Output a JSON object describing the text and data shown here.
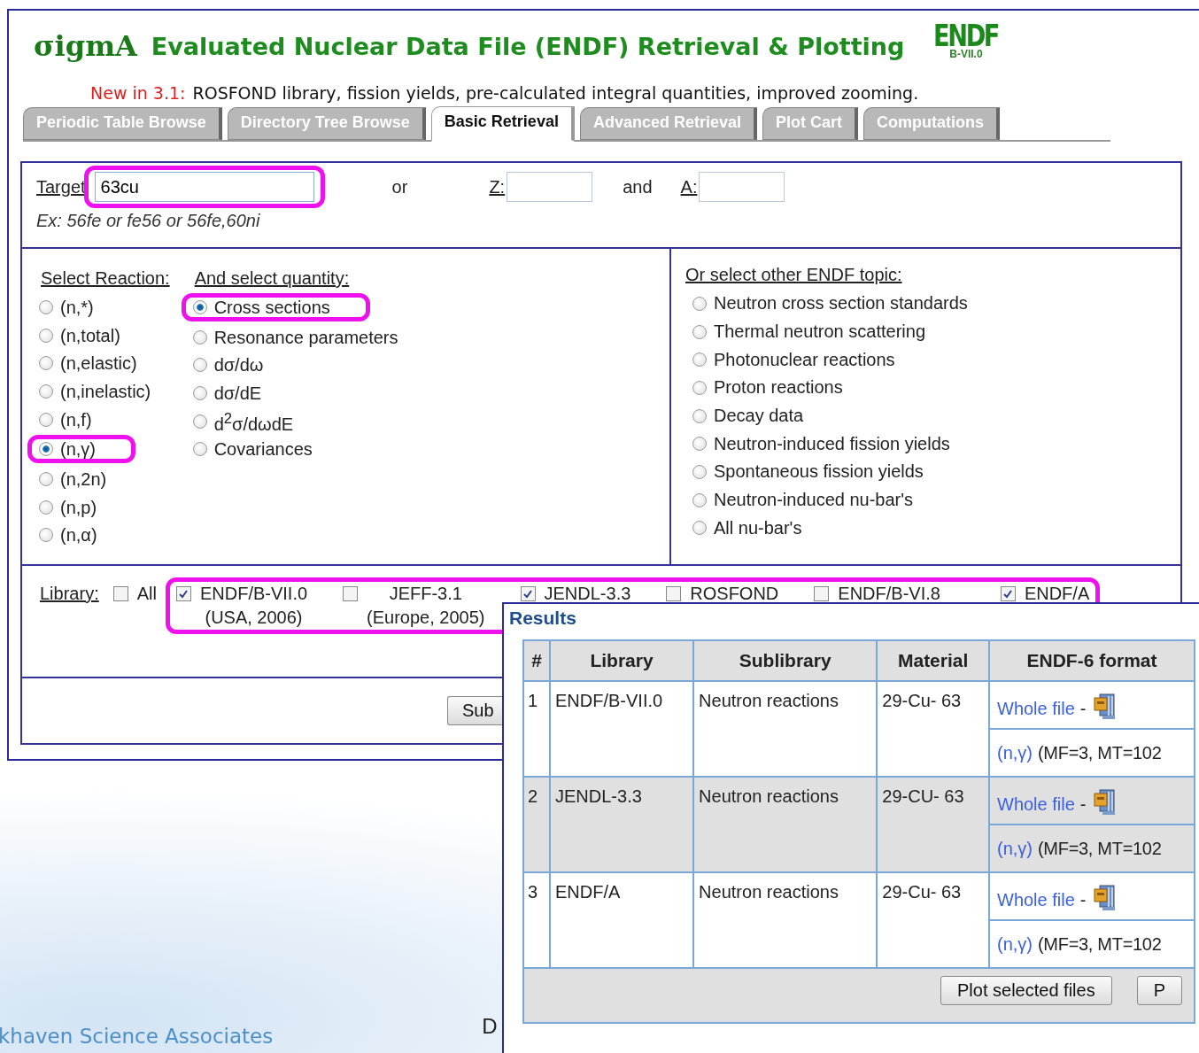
{
  "header": {
    "logo": "σigmA",
    "title": "Evaluated Nuclear Data File (ENDF) Retrieval & Plotting",
    "badge": {
      "title": "ENDF",
      "subtitle": "B-VII.0"
    },
    "news_label": "New in 3.1:",
    "news": "ROSFOND library, fission yields, pre-calculated integral quantities, improved zooming."
  },
  "tabs": [
    {
      "label": "Periodic Table Browse",
      "selected": false
    },
    {
      "label": "Directory Tree Browse",
      "selected": false
    },
    {
      "label": "Basic Retrieval",
      "selected": true
    },
    {
      "label": "Advanced Retrieval",
      "selected": false
    },
    {
      "label": "Plot Cart",
      "selected": false
    },
    {
      "label": "Computations",
      "selected": false
    }
  ],
  "target": {
    "label": "Target",
    "value": "63cu",
    "highlighted": true,
    "or": "or",
    "z_label": "Z:",
    "and": "and",
    "a_label": "A:",
    "example": "Ex: 56fe or fe56 or 56fe,60ni"
  },
  "reactions": {
    "label": "Select Reaction:",
    "items": [
      {
        "label": "(n,*)",
        "selected": false,
        "highlighted": false
      },
      {
        "label": "(n,total)",
        "selected": false,
        "highlighted": false
      },
      {
        "label": "(n,elastic)",
        "selected": false,
        "highlighted": false
      },
      {
        "label": "(n,inelastic)",
        "selected": false,
        "highlighted": false
      },
      {
        "label": "(n,f)",
        "selected": false,
        "highlighted": false
      },
      {
        "label": "(n,γ)",
        "selected": true,
        "highlighted": true
      },
      {
        "label": "(n,2n)",
        "selected": false,
        "highlighted": false
      },
      {
        "label": "(n,p)",
        "selected": false,
        "highlighted": false
      },
      {
        "label": "(n,α)",
        "selected": false,
        "highlighted": false
      }
    ]
  },
  "quantities": {
    "label": "And select quantity:",
    "items": [
      {
        "label": "Cross sections",
        "selected": true,
        "highlighted": true
      },
      {
        "label": "Resonance parameters",
        "selected": false,
        "highlighted": false
      },
      {
        "label": "dσ/dω",
        "selected": false,
        "highlighted": false
      },
      {
        "label": "dσ/dE",
        "selected": false,
        "highlighted": false
      },
      {
        "label": "d$^{2}$σ/dωdE",
        "selected": false,
        "highlighted": false
      },
      {
        "label": "Covariances",
        "selected": false,
        "highlighted": false
      }
    ]
  },
  "topics": {
    "label": "Or select other ENDF topic:",
    "items": [
      {
        "label": "Neutron cross section standards",
        "selected": false
      },
      {
        "label": "Thermal neutron scattering",
        "selected": false
      },
      {
        "label": "Photonuclear reactions",
        "selected": false
      },
      {
        "label": "Proton reactions",
        "selected": false
      },
      {
        "label": "Decay data",
        "selected": false
      },
      {
        "label": "Neutron-induced fission yields",
        "selected": false
      },
      {
        "label": "Spontaneous fission yields",
        "selected": false
      },
      {
        "label": "Neutron-induced nu-bar's",
        "selected": false
      },
      {
        "label": "All nu-bar's",
        "selected": false
      }
    ]
  },
  "library": {
    "label": "Library:",
    "all": {
      "label": "All",
      "checked": false
    },
    "highlighted": true,
    "items": [
      {
        "label": "ENDF/B-VII.0",
        "note": "(USA, 2006)",
        "checked": true
      },
      {
        "label": "JEFF-3.1",
        "note": "(Europe, 2005)",
        "checked": false
      },
      {
        "label": "JENDL-3.3",
        "checked": true
      },
      {
        "label": "ROSFOND",
        "checked": false
      },
      {
        "label": "ENDF/B-VI.8",
        "checked": false
      },
      {
        "label": "ENDF/A",
        "checked": true
      }
    ]
  },
  "submit_button": "Sub",
  "results": {
    "title": "Results",
    "columns": [
      "#",
      "Library",
      "Sublibrary",
      "Material",
      "ENDF-6 format"
    ],
    "rows": [
      {
        "num": "1",
        "library": "ENDF/B-VII.0",
        "sublibrary": "Neutron reactions",
        "material": "29-Cu- 63",
        "selected": false,
        "whole_file": "Whole file",
        "separator": "-",
        "reaction": "(n,γ)",
        "params": "(MF=3, MT=102"
      },
      {
        "num": "2",
        "library": "JENDL-3.3",
        "sublibrary": "Neutron reactions",
        "material": "29-CU- 63",
        "selected": true,
        "whole_file": "Whole file",
        "separator": "-",
        "reaction": "(n,γ)",
        "params": "(MF=3, MT=102"
      },
      {
        "num": "3",
        "library": "ENDF/A",
        "sublibrary": "Neutron reactions",
        "material": "29-Cu- 63",
        "selected": false,
        "whole_file": "Whole file",
        "separator": "-",
        "reaction": "(n,γ)",
        "params": "(MF=3, MT=102"
      }
    ],
    "buttons": [
      "Plot selected files",
      "P"
    ]
  },
  "footer": {
    "org": "khaven Science Associates",
    "mark": "D"
  }
}
